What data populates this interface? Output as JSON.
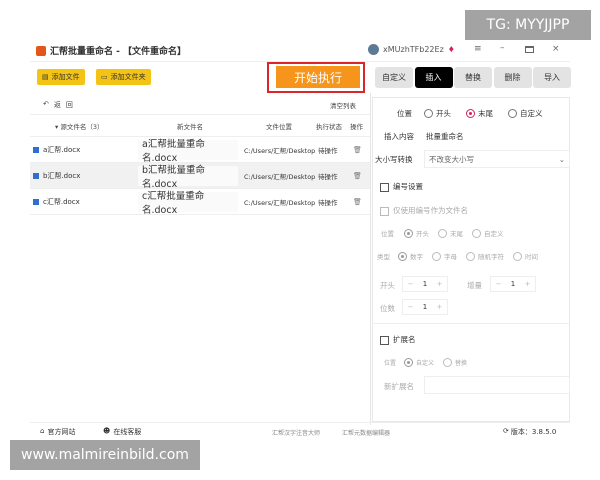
{
  "watermark_top": "TG: MYYJJPP",
  "watermark_bottom": "www.malmireinbild.com",
  "window": {
    "title": "汇帮批量重命名 - 【文件重命名】",
    "username": "xMUzhTFb22Ez"
  },
  "toolbar": {
    "add_file": "添加文件",
    "add_folder": "添加文件夹",
    "start": "开始执行"
  },
  "subbar": {
    "undo": "返",
    "redo": "回",
    "clear": "清空列表"
  },
  "table": {
    "headers": [
      "▾ 源文件名（3）",
      "新文件名",
      "文件位置",
      "执行状态",
      "操作"
    ],
    "rows": [
      {
        "source": "a汇帮.docx",
        "new": "a汇帮批量重命名.docx",
        "location": "C:/Users/汇帮/Desktop",
        "status": "待操作"
      },
      {
        "source": "b汇帮.docx",
        "new": "b汇帮批量重命名.docx",
        "location": "C:/Users/汇帮/Desktop",
        "status": "待操作"
      },
      {
        "source": "c汇帮.docx",
        "new": "c汇帮批量重命名.docx",
        "location": "C:/Users/汇帮/Desktop",
        "status": "待操作"
      }
    ]
  },
  "tabs": [
    {
      "label": "自定义"
    },
    {
      "label": "插入",
      "active": true
    },
    {
      "label": "替换"
    },
    {
      "label": "删除"
    },
    {
      "label": "导入"
    }
  ],
  "insert": {
    "position_label": "位置",
    "position_options": [
      "开头",
      "末尾",
      "自定义"
    ],
    "position_selected": "末尾",
    "content_label": "插入内容",
    "content_value": "批量重命名",
    "case_label": "大小写转换",
    "case_value": "不改变大小写",
    "numbering_label": "编号设置",
    "only_number_label": "仅使用编号作为文件名",
    "num_position_label": "位置",
    "num_position_options": [
      "开头",
      "末尾",
      "自定义"
    ],
    "type_label": "类型",
    "type_options": [
      "数字",
      "字母",
      "随机字符",
      "时间"
    ],
    "start_label": "开头",
    "start_value": "1",
    "increment_label": "增量",
    "increment_value": "1",
    "digits_label": "位数",
    "digits_value": "1",
    "ext_label": "扩展名",
    "ext_position_label": "位置",
    "ext_options": [
      "自定义",
      "替换"
    ],
    "new_ext_label": "新扩展名",
    "new_ext_value": ""
  },
  "footer": {
    "website": "官方网站",
    "support": "在线客服",
    "link1": "汇帮汉字注音大师",
    "link2": "汇帮元数据编辑器",
    "version": "版本：3.8.5.0"
  },
  "colors": {
    "accent": "#f6951c",
    "highlight": "#d8262a",
    "radio": "#d0245a",
    "button_yellow": "#f3c316"
  }
}
